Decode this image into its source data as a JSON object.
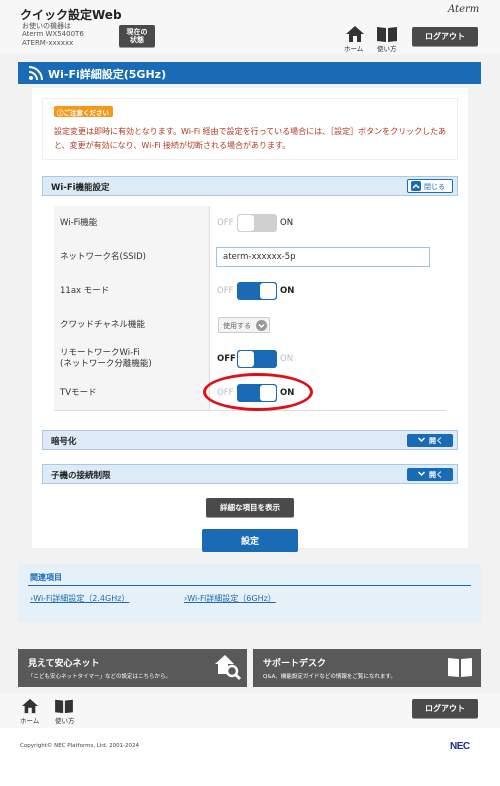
{
  "header": {
    "app_title": "クイック設定Web",
    "device_label": "お使いの機器は",
    "device_model": "Aterm WX5400T6",
    "device_id": "ATERM-xxxxxx",
    "status_button": "現在の\n状態",
    "brand": "Aterm",
    "home_label": "ホーム",
    "help_label": "使い方",
    "logout": "ログアウト"
  },
  "page": {
    "title": "Wi-Fi詳細設定(5GHz)"
  },
  "notice": {
    "badge": "ご注意ください",
    "text": "設定変更は即時に有効となります。Wi-Fi 経由で設定を行っている場合には、［設定］ボタンをクリックしたあと、変更が有効になり、Wi-Fi 接続が切断される場合があります。"
  },
  "wifi_section": {
    "title": "Wi-Fi機能設定",
    "collapse": "閉じる",
    "rows": [
      {
        "label": "Wi-Fi機能",
        "off": "OFF",
        "on": "ON",
        "state": "off"
      },
      {
        "label": "ネットワーク名(SSID)",
        "value": "aterm-xxxxxx-5p"
      },
      {
        "label": "11ax モード",
        "off": "OFF",
        "on": "ON",
        "state": "on"
      },
      {
        "label": "クワッドチャネル機能",
        "select": "使用する"
      },
      {
        "label": "リモートワークWi-Fi\n(ネットワーク分離機能)",
        "off": "OFF",
        "on": "ON",
        "state": "off"
      },
      {
        "label": "TVモード",
        "off": "OFF",
        "on": "ON",
        "state": "on"
      }
    ]
  },
  "encryption": {
    "title": "暗号化",
    "expand": "開く"
  },
  "child_limit": {
    "title": "子機の接続制限",
    "expand": "開く"
  },
  "show_details": "詳細な項目を表示",
  "submit": "設定",
  "related": {
    "title": "関連項目",
    "links": [
      "Wi-Fi詳細設定（2.4GHz）",
      "Wi-Fi詳細設定（6GHz）"
    ]
  },
  "banners": {
    "left_title": "見えて安心ネット",
    "left_sub": "「こども安心ネットタイマー」などの設定はこちらから。",
    "right_title": "サポートデスク",
    "right_sub": "Q&A、機能設定ガイドなどの情報をご覧になれます。"
  },
  "footer": {
    "home_label": "ホーム",
    "help_label": "使い方",
    "logout": "ログアウト",
    "copyright": "Copyright© NEC Platforms, Ltd. 2001-2024",
    "brand": "NEC"
  },
  "colors": {
    "accent": "#1a6bb5",
    "annotation": "#e0101a",
    "notice": "#b03a1e"
  }
}
